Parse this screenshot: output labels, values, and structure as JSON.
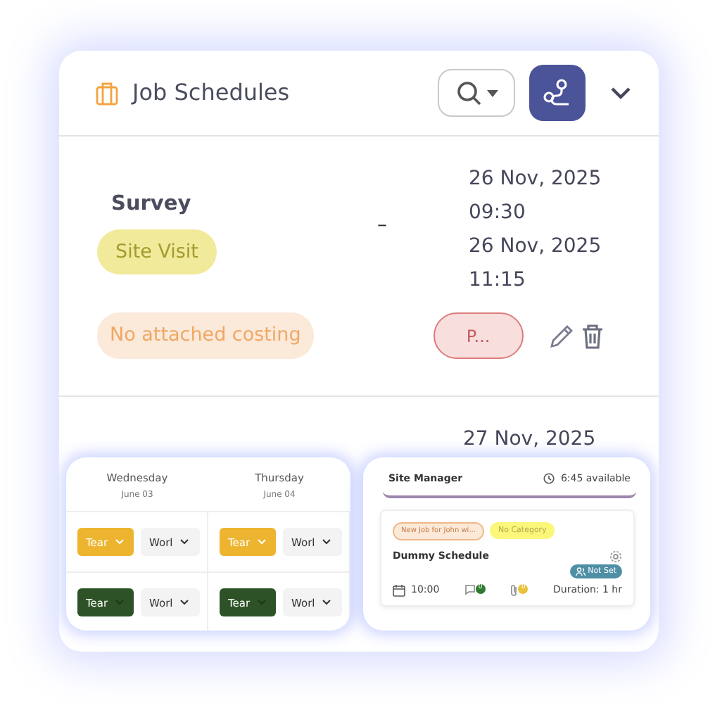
{
  "header": {
    "title": "Job Schedules"
  },
  "jobs": [
    {
      "name": "Survey",
      "category": "Site Visit",
      "separator": "–",
      "start_date": "26 Nov, 2025",
      "start_time": "09:30",
      "end_date": "26 Nov, 2025",
      "end_time": "11:15",
      "costing": "No attached costing",
      "status": "P..."
    },
    {
      "start_date": "27 Nov, 2025"
    }
  ],
  "week_card": {
    "days": [
      {
        "day": "Wednesday",
        "date": "June 03"
      },
      {
        "day": "Thursday",
        "date": "June 04"
      }
    ],
    "rows": [
      {
        "cells": [
          {
            "team": "Tear",
            "color": "#edb52f",
            "work": "Worl"
          },
          {
            "team": "Tear",
            "color": "#edb52f",
            "work": "Worl"
          }
        ]
      },
      {
        "cells": [
          {
            "team": "Tear",
            "color": "#2e5227",
            "work": "Worl"
          },
          {
            "team": "Tear",
            "color": "#2e5227",
            "work": "Worl"
          }
        ]
      }
    ]
  },
  "site_card": {
    "title": "Site Manager",
    "available": "6:45 available",
    "schedule": {
      "job_tag": "New Job for John wi...",
      "category": "No Category",
      "name": "Dummy Schedule",
      "assignee": "Not Set",
      "time": "10:00",
      "comments": "0",
      "attachments": "0",
      "duration": "Duration: 1 hr"
    }
  }
}
